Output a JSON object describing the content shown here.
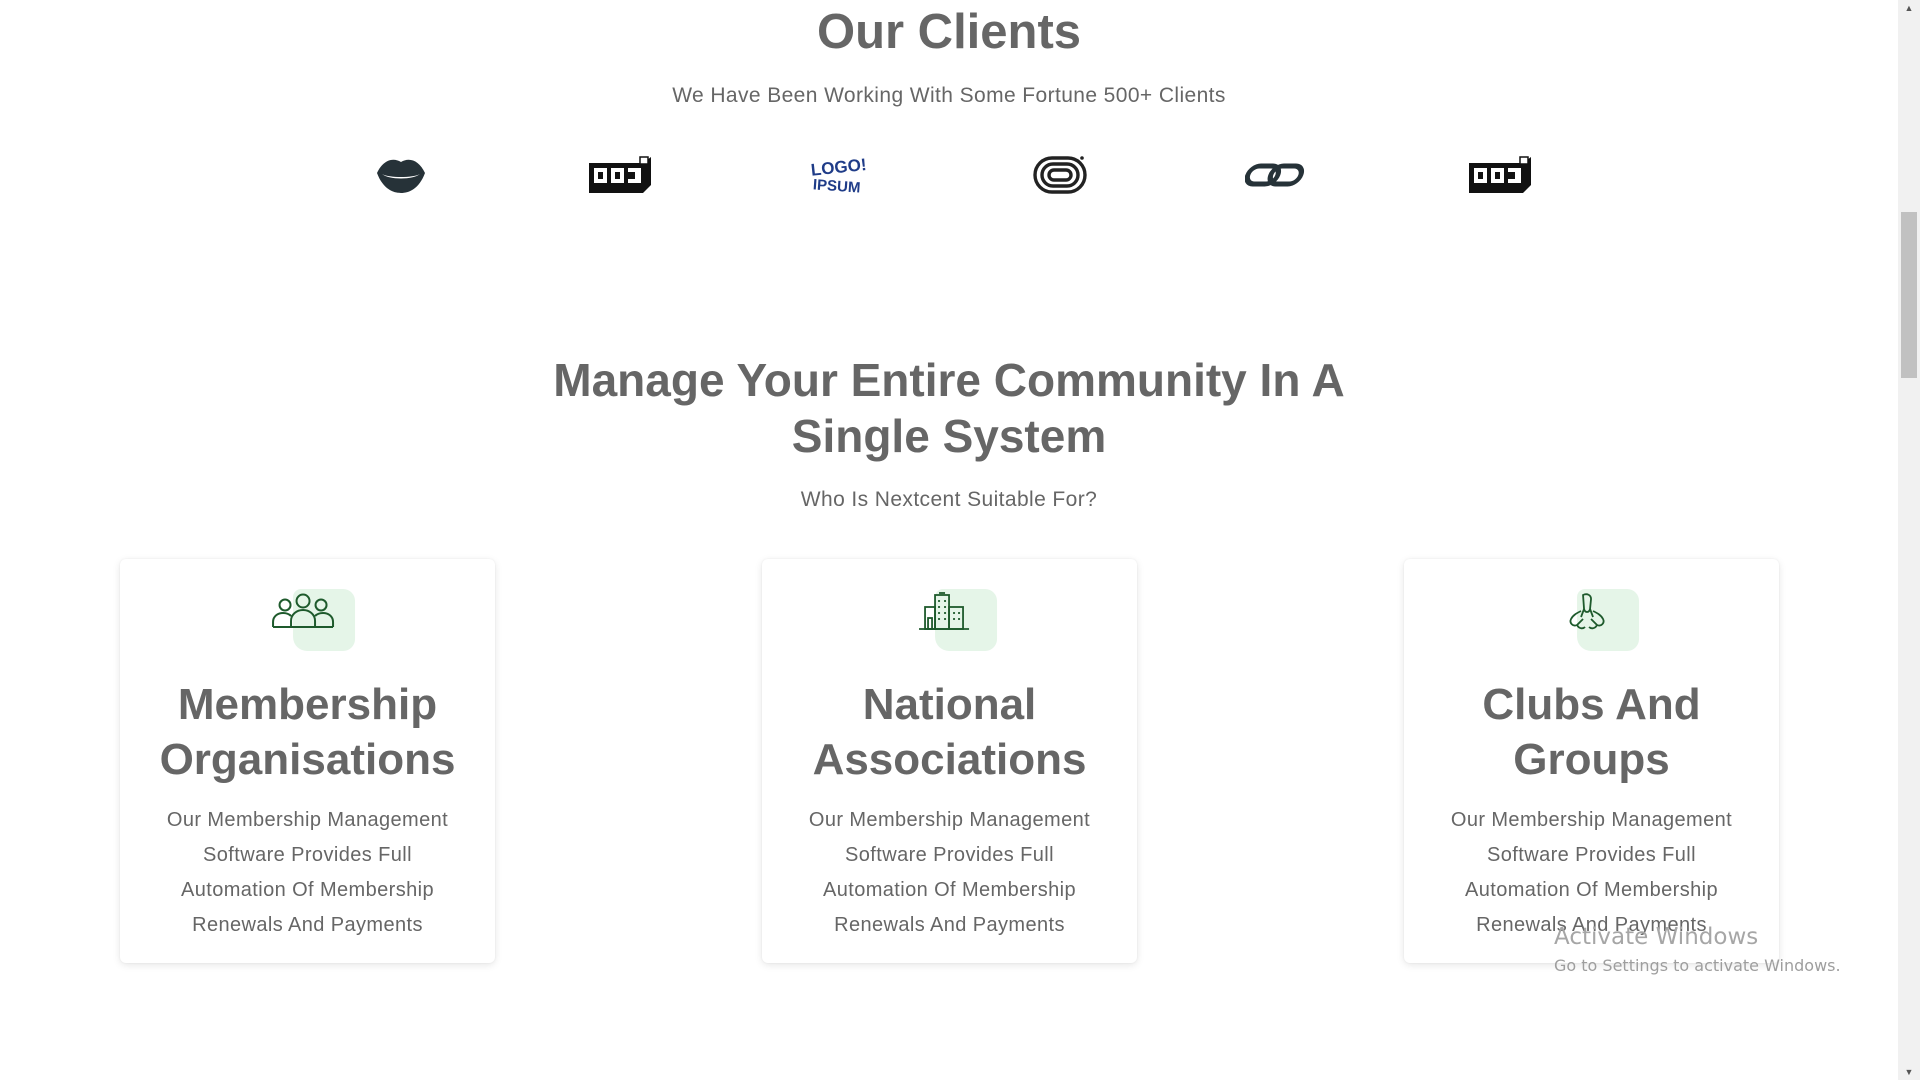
{
  "clients": {
    "title": "Our Clients",
    "subtitle": "We Have Been Working With Some Fortune 500+ Clients",
    "logos": [
      {
        "name": "lips-logo-icon"
      },
      {
        "name": "block-logo-icon"
      },
      {
        "name": "logoipsum-logo-icon",
        "text": "LOGO! IPSUM"
      },
      {
        "name": "spiral-logo-icon"
      },
      {
        "name": "chain-logo-icon"
      },
      {
        "name": "block-logo-icon"
      }
    ]
  },
  "community": {
    "title_line1": "Manage Your Entire Community In A",
    "title_line2": "Single System",
    "subtitle": "Who Is Nextcent Suitable For?",
    "cards": [
      {
        "icon": "people-group-icon",
        "title_line1": "Membership",
        "title_line2": "Organisations",
        "text": "Our Membership Management Software Provides Full Automation Of Membership Renewals And Payments"
      },
      {
        "icon": "building-icon",
        "title_line1": "National",
        "title_line2": "Associations",
        "text": "Our Membership Management Software Provides Full Automation Of Membership Renewals And Payments"
      },
      {
        "icon": "hands-together-icon",
        "title_line1": "Clubs And",
        "title_line2": "Groups",
        "text": "Our Membership Management Software Provides Full Automation Of Membership Renewals And Payments"
      }
    ]
  },
  "watermark": {
    "title": "Activate Windows",
    "subtitle": "Go to Settings to activate Windows."
  },
  "colors": {
    "heading": "#666666",
    "icon_green": "#1e5a2c",
    "icon_bg": "#e5f5e8",
    "logo_dark": "#263238"
  }
}
